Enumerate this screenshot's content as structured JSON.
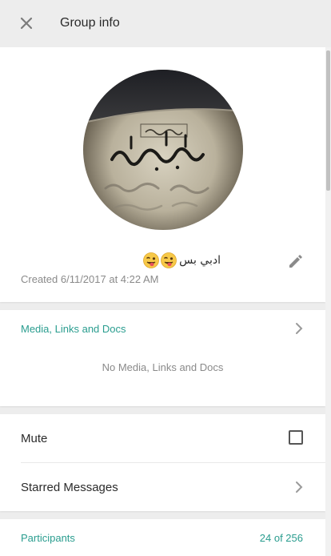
{
  "header": {
    "title": "Group info",
    "close_icon": "close-icon"
  },
  "profile": {
    "group_name": "ادبي بس",
    "emojis": [
      "winking-tongue-emoji",
      "winking-tongue-emoji"
    ],
    "created": "Created 6/11/2017 at 4:22 AM",
    "edit_icon": "pencil-icon"
  },
  "media": {
    "title": "Media, Links and Docs",
    "empty_text": "No Media, Links and Docs"
  },
  "settings": {
    "mute_label": "Mute",
    "mute_checked": false,
    "starred_label": "Starred Messages"
  },
  "participants": {
    "label": "Participants",
    "count": "24 of 256"
  },
  "colors": {
    "accent": "#2a9d8f",
    "header_bg": "#ededed",
    "card_bg": "#ffffff"
  }
}
